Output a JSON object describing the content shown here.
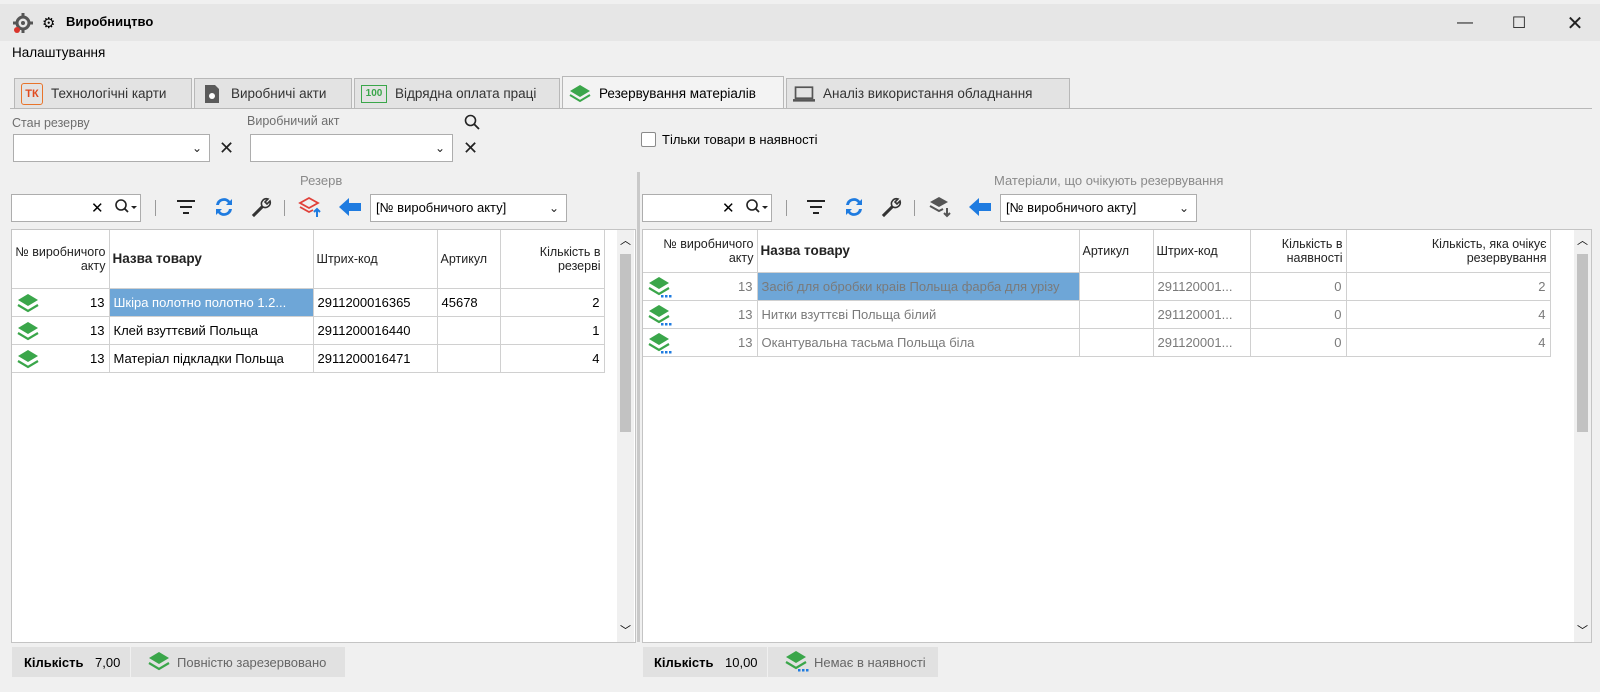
{
  "window": {
    "title": "Виробництво"
  },
  "menu": {
    "settings": "Налаштування"
  },
  "tabs": [
    {
      "label": "Технологічні карти",
      "icon": "tk-card-icon",
      "badge": "ТК"
    },
    {
      "label": "Виробничі акти",
      "icon": "production-act-icon"
    },
    {
      "label": "Відрядна оплата праці",
      "icon": "piecework-pay-icon",
      "badge": "100"
    },
    {
      "label": "Резервування матеріалів",
      "icon": "layers-icon",
      "active": true
    },
    {
      "label": "Аналіз використання обладнання",
      "icon": "laptop-icon"
    }
  ],
  "filters": {
    "reserve_state_label": "Стан резерву",
    "reserve_state_value": "",
    "production_act_label": "Виробничий акт",
    "production_act_value": "",
    "only_in_stock_label": "Тільки товари в наявності",
    "only_in_stock_checked": false
  },
  "left": {
    "title": "Резерв",
    "group_select": "[№ виробничого акту]",
    "columns": [
      "№ виробничого акту",
      "Назва товару",
      "Штрих-код",
      "Артикул",
      "Кількість в резерві"
    ],
    "rows": [
      {
        "act": "13",
        "name": "Шкіра полотно полотно 1.2...",
        "barcode": "2911200016365",
        "article": "45678",
        "qty": "2"
      },
      {
        "act": "13",
        "name": "Клей взуттєвий Польща",
        "barcode": "2911200016440",
        "article": "",
        "qty": "1"
      },
      {
        "act": "13",
        "name": "Матеріал підкладки Польща",
        "barcode": "2911200016471",
        "article": "",
        "qty": "4"
      }
    ],
    "count_label": "Кількість",
    "count_value": "7,00",
    "status_button": "Повністю зарезервовано"
  },
  "right": {
    "title": "Матеріали, що очікують резервування",
    "group_select": "[№ виробничого акту]",
    "columns": [
      "№ виробничого акту",
      "Назва товару",
      "Артикул",
      "Штрих-код",
      "Кількість в наявності",
      "Кількість, яка очікує резервування"
    ],
    "rows": [
      {
        "act": "13",
        "name": "Засіб для обробки краів Польща фарба для урізу",
        "article": "",
        "barcode": "291120001...",
        "in_stock": "0",
        "waiting": "2"
      },
      {
        "act": "13",
        "name": "Нитки взуттєві Польща білий",
        "article": "",
        "barcode": "291120001...",
        "in_stock": "0",
        "waiting": "4"
      },
      {
        "act": "13",
        "name": "Окантувальна тасьма Польща біла",
        "article": "",
        "barcode": "291120001...",
        "in_stock": "0",
        "waiting": "4"
      }
    ],
    "count_label": "Кількість",
    "count_value": "10,00",
    "status_button": "Немає в наявності"
  },
  "colors": {
    "selection": "#6ea6d7",
    "accent_green": "#3aa64a",
    "accent_blue": "#1e7be0",
    "accent_red": "#e0413a"
  }
}
